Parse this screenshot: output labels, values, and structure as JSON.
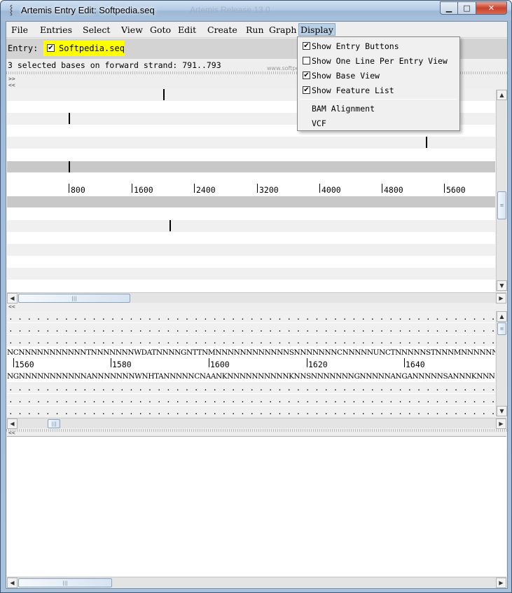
{
  "window": {
    "title": "Artemis Entry Edit: Softpedia.seq",
    "ghost_title": "Artemis Release 13.0",
    "minimize_glyph": "▁",
    "maximize_glyph": "□",
    "close_glyph": "✕",
    "app_icon": "gene-icon"
  },
  "menubar": {
    "items": [
      "File",
      "Entries",
      "Select",
      "View",
      "Goto",
      "Edit",
      "Create",
      "Run",
      "Graph",
      "Display"
    ],
    "active": "Display"
  },
  "entry_bar": {
    "label": "Entry:",
    "entry_name": "Softpedia.seq",
    "entry_checked": true,
    "highlight_color": "#ffff00"
  },
  "status_text": "3 selected bases on forward strand: 791..793",
  "toggles": {
    "expand": ">>",
    "collapse": "<<"
  },
  "overview": {
    "ruler_labels": [
      "800",
      "1600",
      "2400",
      "3200",
      "4000",
      "4800",
      "5600"
    ]
  },
  "base_view": {
    "forward_sequence": "NCNNNNNNNNNNNTNNNNNNNWDATNNNNGNTTNMNNNNNNNNNNNNSNNNNNNNCNNNNNUNCTNNNNNSTNNNMNNNNNNNMNNTNNNNNNNWDATNNNNGNTTNMNNNN",
    "reverse_sequence": "NGNNNNNNNNNNNANNNNNNNWNHTANNNNNCNAANKNNNNNNNNNNKNNSNNNNNNNGNNNNNANGANNNNNSANNNKNNNNNNKNNANNNNNNNWNHTANNNNNCNAAN",
    "ruler_labels": [
      "1560",
      "1580",
      "1600",
      "1620",
      "1640"
    ],
    "frame_dots": ". . . . . . . . . . . . . . . . . . . . . . . . . . . . . . . . . . . . . . . . . . . . . . . . . . . . . . . . . . . . . . . . . . . . . . ."
  },
  "display_menu": {
    "items": [
      {
        "label": "Show Entry Buttons",
        "checked": true
      },
      {
        "label": "Show One Line Per Entry View",
        "checked": false
      },
      {
        "label": "Show Base View",
        "checked": true
      },
      {
        "label": "Show Feature List",
        "checked": true
      },
      {
        "label": "BAM Alignment"
      },
      {
        "label": "VCF"
      }
    ]
  },
  "watermark": "www.softpedia.com"
}
